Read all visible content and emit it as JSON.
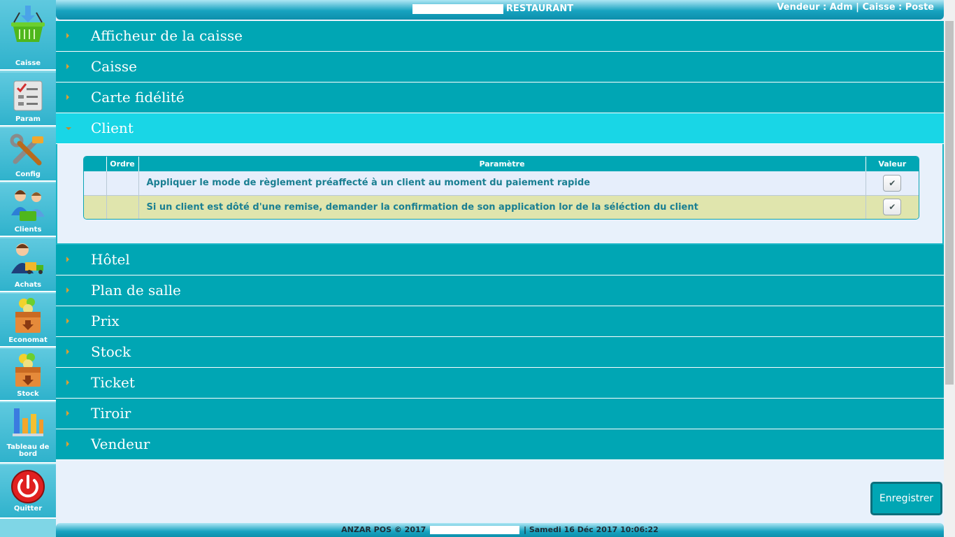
{
  "sidebar": {
    "items": [
      {
        "label": "Caisse",
        "icon": "basket-icon"
      },
      {
        "label": "Param",
        "icon": "checklist-icon"
      },
      {
        "label": "Config",
        "icon": "tools-icon"
      },
      {
        "label": "Clients",
        "icon": "users-icon"
      },
      {
        "label": "Achats",
        "icon": "buyer-icon"
      },
      {
        "label": "Economat",
        "icon": "box-icon"
      },
      {
        "label": "Stock",
        "icon": "stock-box-icon"
      },
      {
        "label": "Tableau de bord",
        "icon": "bar-chart-icon"
      },
      {
        "label": "Quitter",
        "icon": "power-icon"
      }
    ]
  },
  "header": {
    "title": "RESTAURANT",
    "vendor_info": "Vendeur : Adm | Caisse : Poste"
  },
  "accordion": {
    "sections": [
      {
        "label": "Afficheur de la caisse"
      },
      {
        "label": "Caisse"
      },
      {
        "label": "Carte fidélité"
      },
      {
        "label": "Client"
      },
      {
        "label": "Hôtel"
      },
      {
        "label": "Plan de salle"
      },
      {
        "label": "Prix"
      },
      {
        "label": "Stock"
      },
      {
        "label": "Ticket"
      },
      {
        "label": "Tiroir"
      },
      {
        "label": "Vendeur"
      }
    ],
    "active_index": 3
  },
  "client_table": {
    "headers": {
      "col0": "",
      "ordre": "Ordre",
      "parametre": "Paramètre",
      "valeur": "Valeur"
    },
    "rows": [
      {
        "ordre": "",
        "parametre": "Appliquer le mode de règlement préaffecté à un client au moment du paiement rapide",
        "valeur": true,
        "mark": "✔"
      },
      {
        "ordre": "",
        "parametre": "Si un client est dôté d'une remise, demander la confirmation de son application lor de la séléction du client",
        "valeur": true,
        "mark": "✔"
      }
    ]
  },
  "actions": {
    "save_label": "Enregistrer"
  },
  "footer": {
    "left": "ANZAR POS © 2017",
    "right": "| Samedi 16 Déc 2017 10:06:22"
  },
  "colors": {
    "accent": "#00a6b4",
    "active": "#19d6e6",
    "row_alt": "#e0e5ad"
  }
}
